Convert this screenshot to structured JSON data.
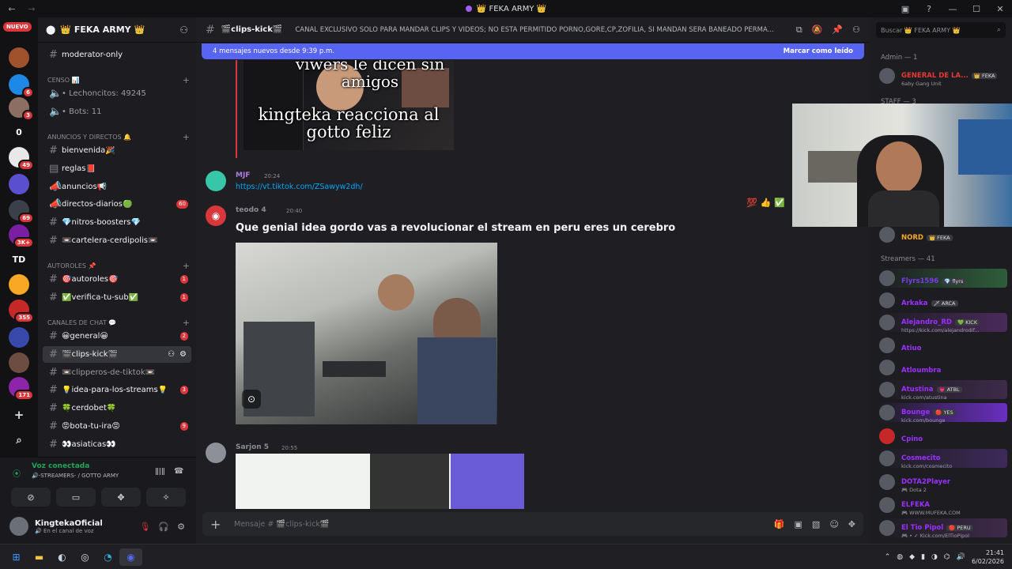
{
  "window": {
    "title": "👑 FEKA ARMY 👑",
    "controls": [
      "—",
      "☐",
      "✕"
    ]
  },
  "rail": {
    "new_badge": "NUEVO",
    "servers": [
      {
        "label": "",
        "color": "#a0522d",
        "badge": ""
      },
      {
        "label": "",
        "color": "#1e88e5",
        "badge": "6"
      },
      {
        "label": "",
        "color": "#8d6e63",
        "badge": "3"
      },
      {
        "label": "0",
        "color": "#121214",
        "badge": ""
      },
      {
        "label": "",
        "color": "#e8e8e8",
        "badge": "49"
      },
      {
        "label": "",
        "color": "#5a4fcf",
        "badge": ""
      },
      {
        "label": "",
        "color": "#3a3f4a",
        "badge": "69"
      },
      {
        "label": "",
        "color": "#7b1fa2",
        "badge": "3K+"
      },
      {
        "label": "TD",
        "color": "#121214",
        "badge": ""
      },
      {
        "label": "",
        "color": "#f9a825",
        "badge": ""
      },
      {
        "label": "",
        "color": "#c62828",
        "badge": "355"
      },
      {
        "label": "",
        "color": "#3949ab",
        "badge": ""
      },
      {
        "label": "",
        "color": "#6d4c41",
        "badge": ""
      },
      {
        "label": "",
        "color": "#8e24aa",
        "badge": "171"
      }
    ],
    "add_server_icon": "+",
    "discover_icon": "⌕"
  },
  "sidebar": {
    "guild_name": "👑 FEKA ARMY 👑",
    "channels_top": [
      {
        "name": "moderator-only",
        "badge": "",
        "icon": "#"
      }
    ],
    "cat_censo": "CENSO 📊",
    "censo": [
      {
        "name": "• Lechoncitos: 49245"
      },
      {
        "name": "• Bots: 11"
      }
    ],
    "cat_anuncios": "ANUNCIOS Y DIRECTOS 🔔",
    "anuncios": [
      {
        "name": "bienvenida🎉",
        "badge": ""
      },
      {
        "name": "reglas📕",
        "badge": ""
      },
      {
        "name": "anuncios📢",
        "badge": ""
      },
      {
        "name": "directos-diarios🟢",
        "badge": "60"
      },
      {
        "name": "💎nitros-boosters💎",
        "badge": ""
      },
      {
        "name": "📼cartelera-cerdipolis📼",
        "badge": ""
      }
    ],
    "cat_autoroles": "AUTOROLES 📌",
    "autoroles": [
      {
        "name": "🎯autoroles🎯",
        "badge": "1"
      },
      {
        "name": "✅verifica-tu-sub✅",
        "badge": "1"
      }
    ],
    "cat_chat": "CANALES DE CHAT 💬",
    "chat": [
      {
        "name": "😀general😀",
        "badge": "2"
      },
      {
        "name": "🎬clips-kick🎬",
        "badge": ""
      },
      {
        "name": "📼clipperos-de-tiktok📼",
        "badge": ""
      },
      {
        "name": "💡idea-para-los-streams💡",
        "badge": "3"
      },
      {
        "name": "🍀cerdobet🍀",
        "badge": ""
      },
      {
        "name": "😡bota-tu-ira😡",
        "badge": "9"
      },
      {
        "name": "👀asiaticas👀",
        "badge": ""
      }
    ]
  },
  "voice": {
    "status": "Voz conectada",
    "channel": "🔊-STREAMERS- / GOTTO ARMY",
    "user_name": "KingtekaOficial",
    "user_status": "🔊 En el canal de voz"
  },
  "header": {
    "channel_name": "🎬clips-kick🎬",
    "topic": "CANAL EXCLUSIVO SOLO PARA MANDAR CLIPS Y VIDEOS; NO ESTA PERMITIDO PORNO,GORE,CP,ZOFILIA, SI MANDAN SERA BANEADO PERMA..."
  },
  "new_messages": {
    "text": "4 mensajes nuevos desde 9:39 p.m.",
    "mark_read": "Marcar como leído"
  },
  "messages": [
    {
      "thumb_caption_1": "viwers le dicen sin amigos",
      "thumb_caption_2": "kingteka reacciona al gotto feliz"
    },
    {
      "user": "MJF",
      "time": "20:24",
      "link": "https://vt.tiktok.com/ZSawyw2dh/"
    },
    {
      "user": "teodo 4",
      "time": "20:40",
      "text": "Que genial idea gordo vas a revolucionar el stream en peru eres un cerebro"
    },
    {
      "user": "Sarjon 5",
      "time": "20:55"
    }
  ],
  "composer": {
    "placeholder": "Mensaje # 🎬clips-kick🎬"
  },
  "members": {
    "search_placeholder": "Buscar 👑 FEKA ARMY 👑",
    "cat_admin": "Admin — 1",
    "admin": [
      {
        "name": "GENERAL DE LA...",
        "color": "#e53935",
        "tag": "👑 FEKA",
        "sub": "6aby Gang Unit"
      }
    ],
    "cat_staff": "STAFF — 3",
    "staff_visible": [
      {
        "name": "NORD",
        "color": "#f9a825",
        "tag": "👑 FEKA",
        "sub": ""
      }
    ],
    "cat_streamers": "Streamers — 41",
    "streamers": [
      {
        "name": "Flyrs1596",
        "color": "#7c3aed",
        "tag": "💎 flyrs",
        "sub": ""
      },
      {
        "name": "Arkaka",
        "color": "#9b30ff",
        "tag": "🗡 ARCA",
        "sub": ""
      },
      {
        "name": "Alejandro_RD",
        "color": "#9b30ff",
        "tag": "💚 KICK",
        "sub": "https://kick.com/alejandrodif..."
      },
      {
        "name": "Atiuo",
        "color": "#9b30ff",
        "tag": "",
        "sub": ""
      },
      {
        "name": "Atloumbra",
        "color": "#9b30ff",
        "tag": "",
        "sub": ""
      },
      {
        "name": "Atustina",
        "color": "#9b30ff",
        "tag": "💗 ATBL",
        "sub": "kick.com/atustina"
      },
      {
        "name": "Bounge",
        "color": "#9b30ff",
        "tag": "🔴 YES",
        "sub": "kick.com/bounge"
      },
      {
        "name": "Cpino",
        "color": "#9b30ff",
        "tag": "",
        "sub": ""
      },
      {
        "name": "Cosmecito",
        "color": "#9b30ff",
        "tag": "",
        "sub": "kick.com/cosmecito"
      },
      {
        "name": "DOTA2Player",
        "color": "#9b30ff",
        "tag": "",
        "sub": "🎮 Dota 2"
      },
      {
        "name": "ELFEKA",
        "color": "#9b30ff",
        "tag": "",
        "sub": "🎮 WWW.MUFEKA.COM"
      },
      {
        "name": "El Tio Pipol",
        "color": "#9b30ff",
        "tag": "🔴 PERU",
        "sub": "🎮 • ✓ Kick.com/ElTioPipol"
      }
    ]
  },
  "taskbar": {
    "time": "21:41",
    "date": "6/02/2026"
  }
}
